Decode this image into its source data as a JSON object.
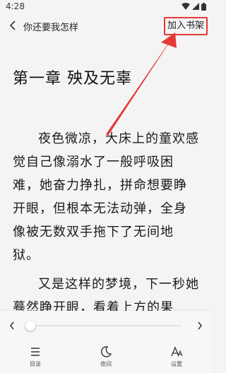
{
  "status": {
    "time": "4:28"
  },
  "header": {
    "title": "你还要我怎样",
    "add_shelf_label": "加入书架"
  },
  "chapter": {
    "title": "第一章  殃及无辜",
    "paragraphs": [
      "夜色微凉，大床上的童欢感觉自己像溺水了一般呼吸困难，她奋力挣扎，拼命想要睁开眼，但根本无法动弹，全身像被无数双手拖下了无间地狱。",
      "又是这样的梦境，下一秒她蓦然睁开眼，看着上方的果"
    ]
  },
  "bottom": {
    "progress": 0.0,
    "tabs": [
      {
        "label": "目录",
        "icon": "catalog-icon"
      },
      {
        "label": "夜间",
        "icon": "moon-icon"
      },
      {
        "label": "设置",
        "icon": "font-settings-icon"
      }
    ]
  },
  "colors": {
    "annotation": "#e53935",
    "text": "#1a1a1a",
    "background": "#f4f4f4"
  }
}
